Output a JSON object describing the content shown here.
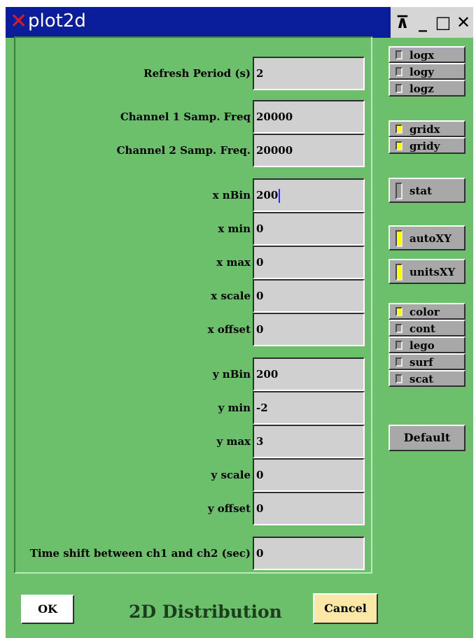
{
  "window": {
    "title": "plot2d",
    "title_icon_glyph": "✕",
    "wm_buttons": [
      {
        "name": "pin-icon",
        "glyph": "⊼"
      },
      {
        "name": "minimize-icon",
        "glyph": "_"
      },
      {
        "name": "maximize-icon",
        "glyph": "□"
      },
      {
        "name": "close-icon",
        "glyph": "✕"
      }
    ]
  },
  "fields": {
    "refresh_period": {
      "label": "Refresh Period (s)",
      "value": "2"
    },
    "ch1_freq": {
      "label": "Channel 1 Samp. Freq",
      "value": "20000"
    },
    "ch2_freq": {
      "label": "Channel 2 Samp. Freq.",
      "value": "20000"
    },
    "x_nbin": {
      "label": "x nBin",
      "value": "200"
    },
    "x_min": {
      "label": "x min",
      "value": "0"
    },
    "x_max": {
      "label": "x max",
      "value": "0"
    },
    "x_scale": {
      "label": "x scale",
      "value": "0"
    },
    "x_offset": {
      "label": "x offset",
      "value": "0"
    },
    "y_nbin": {
      "label": "y nBin",
      "value": "200"
    },
    "y_min": {
      "label": "y min",
      "value": "-2"
    },
    "y_max": {
      "label": "y max",
      "value": "3"
    },
    "y_scale": {
      "label": "y scale",
      "value": "0"
    },
    "y_offset": {
      "label": "y offset",
      "value": "0"
    },
    "time_shift": {
      "label": "Time shift between ch1 and ch2 (sec)",
      "value": "0"
    }
  },
  "toggles": {
    "logx": {
      "label": "logx",
      "checked": false
    },
    "logy": {
      "label": "logy",
      "checked": false
    },
    "logz": {
      "label": "logz",
      "checked": false
    },
    "gridx": {
      "label": "gridx",
      "checked": true
    },
    "gridy": {
      "label": "gridy",
      "checked": true
    },
    "stat": {
      "label": "stat",
      "checked": false
    },
    "autoxy": {
      "label": "autoXY",
      "checked": true
    },
    "unitsxy": {
      "label": "unitsXY",
      "checked": true
    },
    "color": {
      "label": "color",
      "checked": true
    },
    "cont": {
      "label": "cont",
      "checked": false
    },
    "lego": {
      "label": "lego",
      "checked": false
    },
    "surf": {
      "label": "surf",
      "checked": false
    },
    "scat": {
      "label": "scat",
      "checked": false
    }
  },
  "buttons": {
    "default": "Default",
    "ok": "OK",
    "cancel": "Cancel"
  },
  "bottom_title": "2D Distribution",
  "colors": {
    "window_bg": "#6cc06b",
    "titlebar": "#0a1e9c",
    "indicator_on": "#ffff00",
    "cancel_bg": "#fce8a6"
  }
}
